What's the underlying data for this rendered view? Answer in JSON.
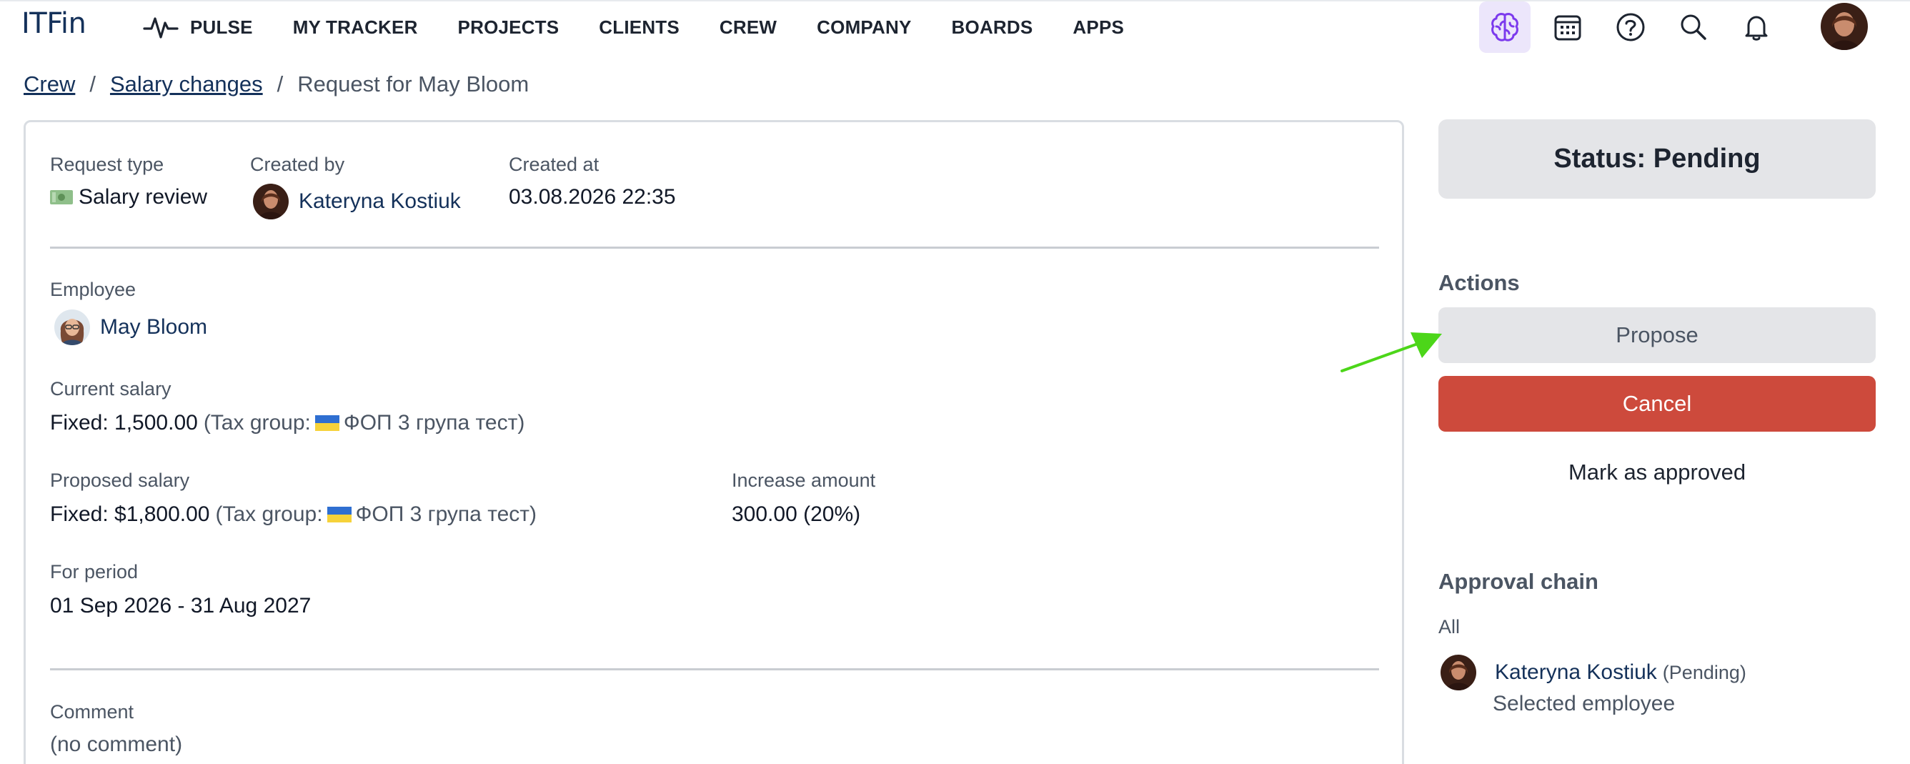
{
  "app": {
    "logo": "ITFin"
  },
  "nav": {
    "items": [
      {
        "label": "PULSE"
      },
      {
        "label": "MY TRACKER"
      },
      {
        "label": "PROJECTS"
      },
      {
        "label": "CLIENTS"
      },
      {
        "label": "CREW"
      },
      {
        "label": "COMPANY"
      },
      {
        "label": "BOARDS"
      },
      {
        "label": "APPS"
      }
    ],
    "icons": [
      "brain-icon",
      "calendar-icon",
      "help-icon",
      "search-icon",
      "bell-icon"
    ]
  },
  "breadcrumb": {
    "crew": "Crew",
    "salary_changes": "Salary changes",
    "current": "Request for May Bloom",
    "separator": "/"
  },
  "request": {
    "type_label": "Request type",
    "type_value": "Salary review",
    "created_by_label": "Created by",
    "created_by_value": "Kateryna Kostiuk",
    "created_at_label": "Created at",
    "created_at_value": "03.08.2026 22:35",
    "employee_label": "Employee",
    "employee_value": "May Bloom",
    "current_salary_label": "Current salary",
    "current_salary_value": "Fixed: 1,500.00",
    "current_tax_prefix": "(Tax group:",
    "current_tax_group": "ФОП 3 група тест)",
    "proposed_salary_label": "Proposed salary",
    "proposed_salary_value": "Fixed: $1,800.00",
    "proposed_tax_prefix": "(Tax group:",
    "proposed_tax_group": "ФОП 3 група тест)",
    "increase_label": "Increase amount",
    "increase_value": "300.00 (20%)",
    "period_label": "For period",
    "period_value": "01 Sep 2026 - 31 Aug 2027",
    "comment_label": "Comment",
    "comment_value": "(no comment)"
  },
  "sidebar": {
    "status": "Status: Pending",
    "actions_title": "Actions",
    "propose": "Propose",
    "cancel": "Cancel",
    "mark_approved": "Mark as approved",
    "chain_title": "Approval chain",
    "chain_filter": "All",
    "approver_name": "Kateryna Kostiuk",
    "approver_status": "(Pending)",
    "approver_role": "Selected employee"
  },
  "colors": {
    "brand": "#14315a",
    "cancel": "#cd4a3c",
    "status_bg": "#e4e5e8",
    "active_icon_bg": "#ece6fb",
    "annotation_arrow": "#4cd619"
  }
}
